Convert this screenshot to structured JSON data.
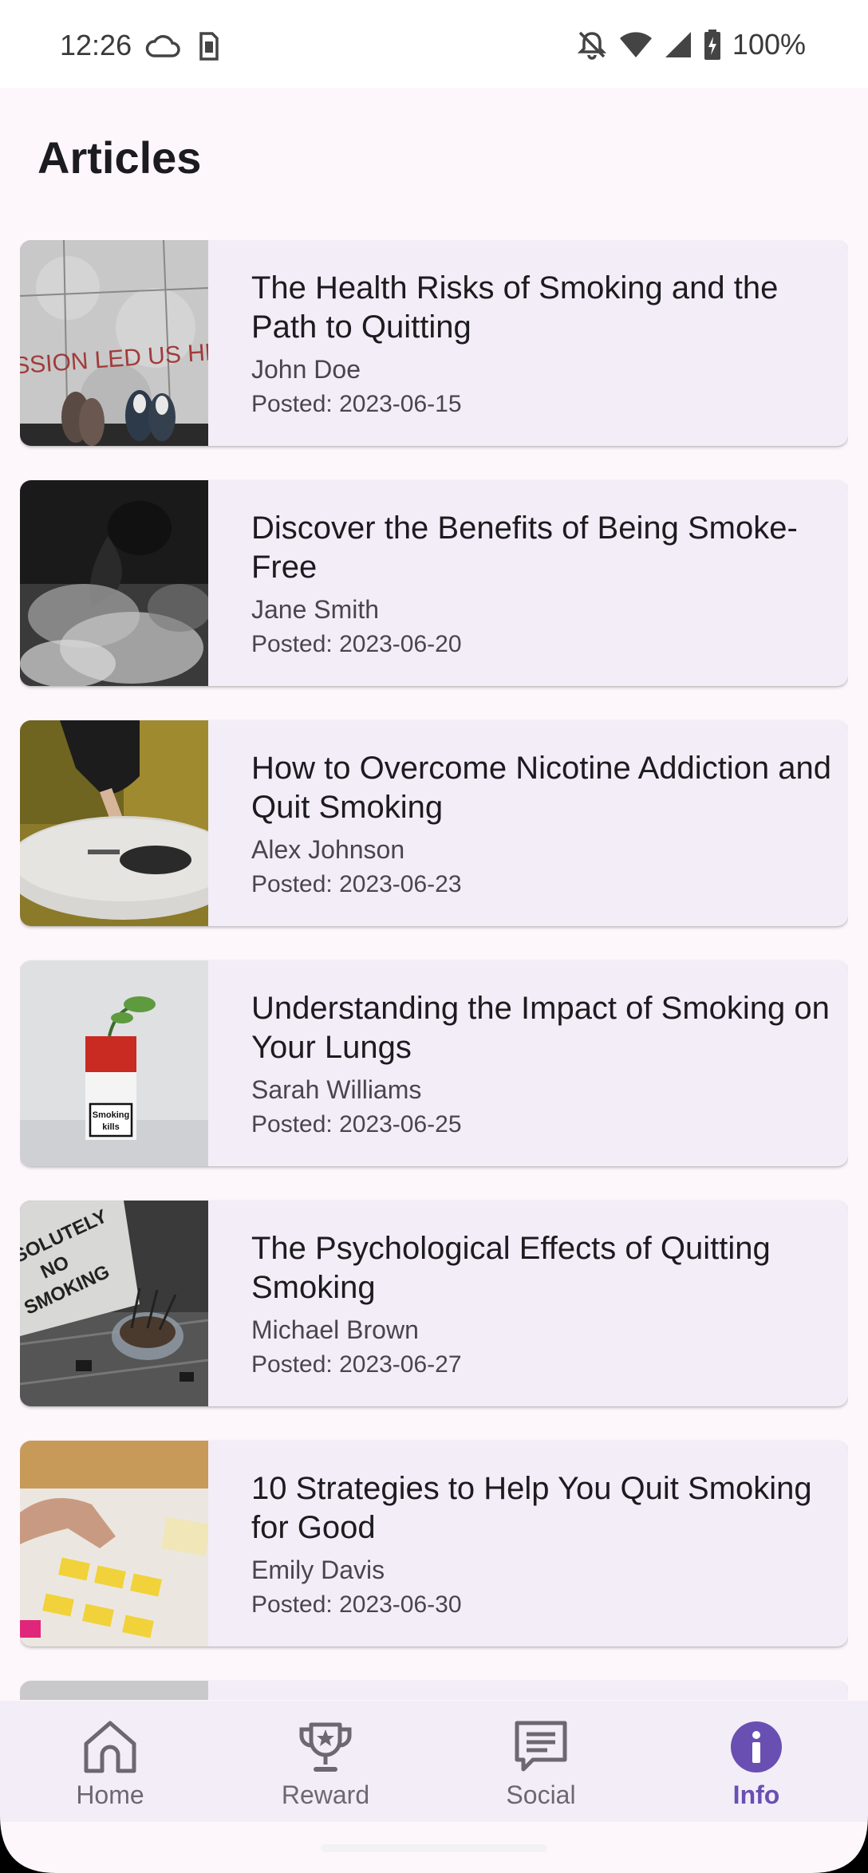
{
  "status_bar": {
    "time": "12:26",
    "battery": "100%",
    "icons": [
      "cloud-icon",
      "sim-icon",
      "mute-icon",
      "wifi-icon",
      "signal-icon",
      "battery-icon"
    ]
  },
  "page": {
    "title": "Articles"
  },
  "articles": [
    {
      "title": "The Health Risks of Smoking and the Path to Quitting",
      "author": "John Doe",
      "posted": "Posted: 2023-06-15",
      "thumbnail": "street-shoes-photo"
    },
    {
      "title": "Discover the Benefits of Being Smoke-Free",
      "author": "Jane Smith",
      "posted": "Posted: 2023-06-20",
      "thumbnail": "smoke-portrait-photo"
    },
    {
      "title": "How to Overcome Nicotine Addiction and Quit Smoking",
      "author": "Alex Johnson",
      "posted": "Posted: 2023-06-23",
      "thumbnail": "ashtray-hand-photo"
    },
    {
      "title": "Understanding the Impact of Smoking on Your Lungs",
      "author": "Sarah Williams",
      "posted": "Posted: 2023-06-25",
      "thumbnail": "cigarette-pack-plant-photo",
      "thumbnail_text": "Smoking kills"
    },
    {
      "title": "The Psychological Effects of Quitting Smoking",
      "author": "Michael Brown",
      "posted": "Posted: 2023-06-27",
      "thumbnail": "no-smoking-sign-photo",
      "thumbnail_text": "SOLUTELY NO SMOKING"
    },
    {
      "title": "10 Strategies to Help You Quit Smoking for Good",
      "author": "Emily Davis",
      "posted": "Posted: 2023-06-30",
      "thumbnail": "sticky-notes-photo"
    }
  ],
  "bottom_nav": {
    "items": [
      {
        "label": "Home",
        "icon": "home-icon",
        "active": false
      },
      {
        "label": "Reward",
        "icon": "trophy-icon",
        "active": false
      },
      {
        "label": "Social",
        "icon": "chat-icon",
        "active": false
      },
      {
        "label": "Info",
        "icon": "info-icon",
        "active": true
      }
    ]
  },
  "colors": {
    "background": "#fdf7fb",
    "card": "#f3edf7",
    "accent": "#6a4fb3",
    "text_primary": "#1c1b1f",
    "text_secondary": "#49454f"
  }
}
